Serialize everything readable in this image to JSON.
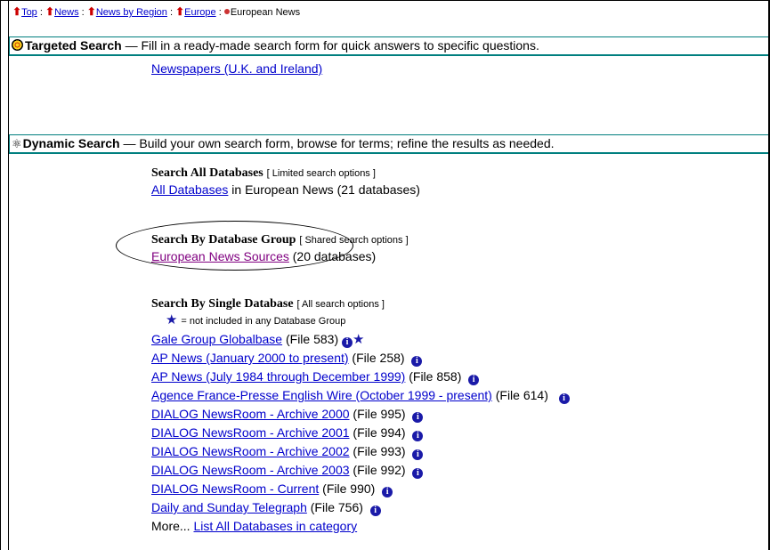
{
  "breadcrumb": {
    "top": "Top",
    "news": "News",
    "news_by_region": "News by Region",
    "europe": "Europe",
    "current": "European News",
    "sep": ":"
  },
  "targeted": {
    "title": "Targeted Search",
    "desc": "— Fill in a ready-made search form for quick answers to specific questions.",
    "link": "Newspapers (U.K. and Ireland)"
  },
  "dynamic": {
    "title": "Dynamic Search",
    "desc": "— Build your own search form, browse for terms; refine the results as needed."
  },
  "search_all": {
    "heading": "Search All Databases",
    "note": "[ Limited search options ]",
    "link": "All Databases",
    "suffix": " in European News (21 databases)"
  },
  "search_group": {
    "heading": "Search By Database Group",
    "note": "[ Shared search options ]",
    "link": "European News Sources",
    "suffix": " (20 databases)"
  },
  "search_single": {
    "heading": "Search By Single Database",
    "note": "[ All search options ]",
    "legend": "= not included in any Database Group",
    "items": [
      {
        "name": "Gale Group Globalbase",
        "file": " (File 583)"
      },
      {
        "name": "AP News (January 2000 to present)",
        "file": " (File 258)"
      },
      {
        "name": "AP News (July 1984 through December 1999)",
        "file": " (File 858)"
      },
      {
        "name": "Agence France-Presse English Wire (October 1999 - present)",
        "file": " (File 614)"
      },
      {
        "name": "DIALOG NewsRoom - Archive 2000",
        "file": " (File 995)"
      },
      {
        "name": "DIALOG NewsRoom - Archive 2001",
        "file": " (File 994)"
      },
      {
        "name": "DIALOG NewsRoom - Archive 2002",
        "file": " (File 993)"
      },
      {
        "name": "DIALOG NewsRoom - Archive 2003",
        "file": " (File 992)"
      },
      {
        "name": "DIALOG NewsRoom - Current",
        "file": " (File 990)"
      },
      {
        "name": "Daily and Sunday Telegraph",
        "file": " (File 756)"
      }
    ],
    "more_label": "More...",
    "more_link": "List All Databases in category"
  },
  "icons": {
    "info": "i",
    "star": "★",
    "arrow": "⬆",
    "atom": "⚛"
  },
  "colors": {
    "link": "#0000cc",
    "visited": "#800080",
    "bar_border": "#007f7f",
    "info": "#1a1aa8"
  }
}
